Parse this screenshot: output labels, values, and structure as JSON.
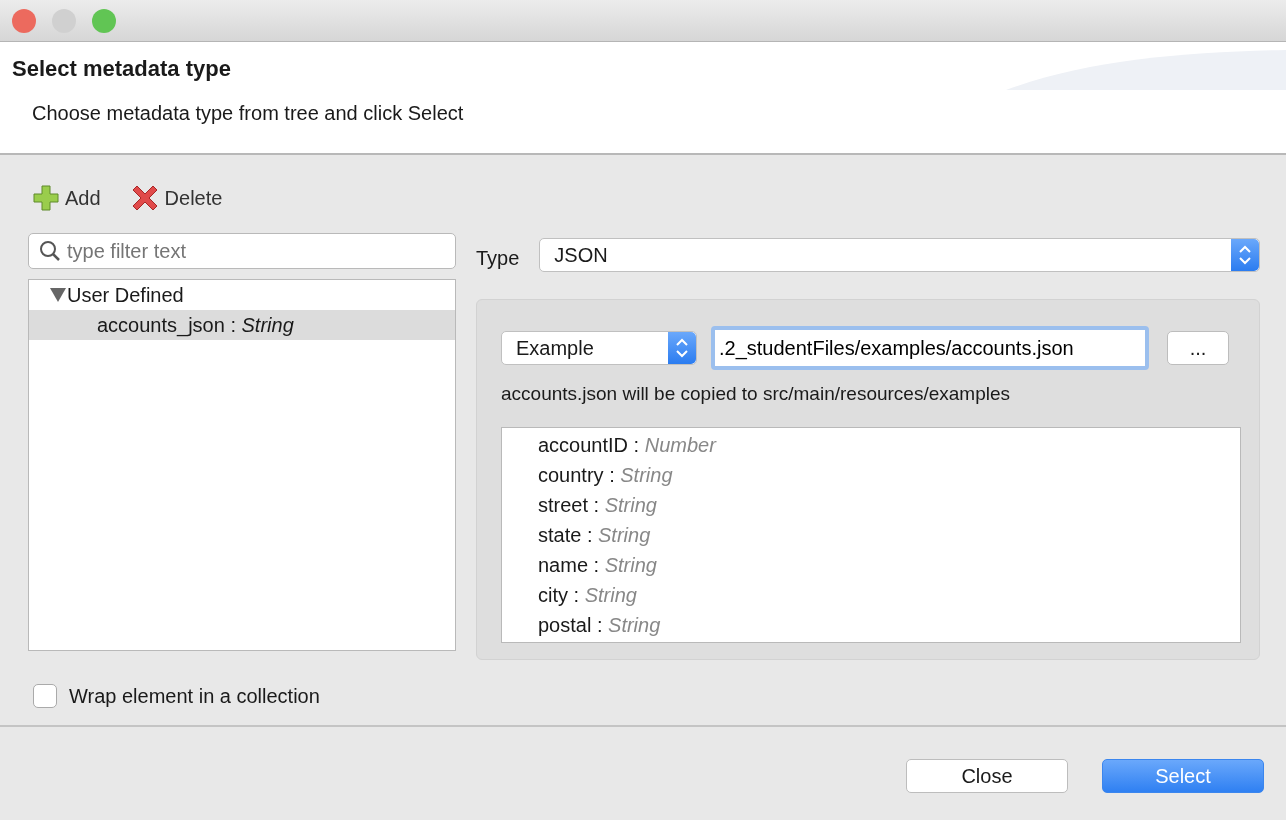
{
  "window": {
    "title": "Select metadata type",
    "subtitle": "Choose metadata type from tree and click Select"
  },
  "toolbar": [
    {
      "kind": "add",
      "label": "Add"
    },
    {
      "kind": "delete",
      "label": "Delete"
    }
  ],
  "filter": {
    "placeholder": "type filter text"
  },
  "tree": [
    {
      "label": "User Defined",
      "expanded": true,
      "children": [
        {
          "name": "accounts_json :",
          "type": "String",
          "selected": true
        }
      ]
    }
  ],
  "type_select": {
    "label": "Type",
    "value": "JSON"
  },
  "source": {
    "mode": "Example",
    "path": ".2_studentFiles/examples/accounts.json",
    "browse": "...",
    "note": "accounts.json will be copied to src/main/resources/examples"
  },
  "fields": [
    {
      "name": "accountID :",
      "type": "Number"
    },
    {
      "name": "country :",
      "type": "String"
    },
    {
      "name": "street :",
      "type": "String"
    },
    {
      "name": "state :",
      "type": "String"
    },
    {
      "name": "name :",
      "type": "String"
    },
    {
      "name": "city :",
      "type": "String"
    },
    {
      "name": "postal :",
      "type": "String"
    }
  ],
  "wrap": {
    "label": "Wrap element in a collection",
    "checked": false
  },
  "buttons": [
    {
      "label": "Close",
      "kind": "default"
    },
    {
      "label": "Select",
      "kind": "primary"
    }
  ]
}
